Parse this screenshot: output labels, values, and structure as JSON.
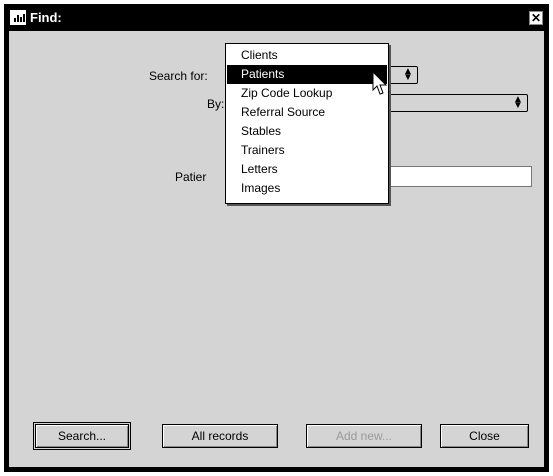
{
  "window": {
    "title": "Find:",
    "close_glyph": "✕",
    "app_icon": "chart-icon"
  },
  "form": {
    "search_for_label": "Search for:",
    "search_for_value": "",
    "by_label": "By:",
    "by_value": "",
    "field_label_visible": "Patier",
    "field_value": ""
  },
  "dropdown": {
    "options": [
      "Clients",
      "Patients",
      "Zip Code Lookup",
      "Referral Source",
      "Stables",
      "Trainers",
      "Letters",
      "Images"
    ],
    "highlighted": "Patients"
  },
  "buttons": {
    "search": "Search...",
    "all_records": "All records",
    "add_new": "Add new...",
    "close": "Close"
  }
}
